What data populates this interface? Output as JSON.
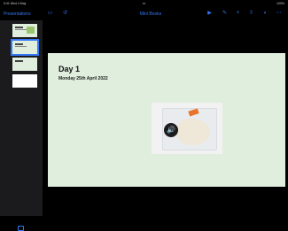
{
  "status_bar": {
    "left": "9:41 Wed 4 May",
    "center": "•••",
    "right": "100%"
  },
  "toolbar": {
    "back_label": "Presentations",
    "title": "Mini Books",
    "icons": [
      "sidebar-icon",
      "undo-icon",
      "play-icon",
      "brush-icon",
      "insert-icon",
      "share-icon",
      "format-icon",
      "more-icon"
    ]
  },
  "sidebar": {
    "slides": 4,
    "selected_slide": 2
  },
  "slide": {
    "title": "Day 1",
    "subtitle": "Monday 25th April 2022",
    "audio_icon": "speaker-icon"
  }
}
